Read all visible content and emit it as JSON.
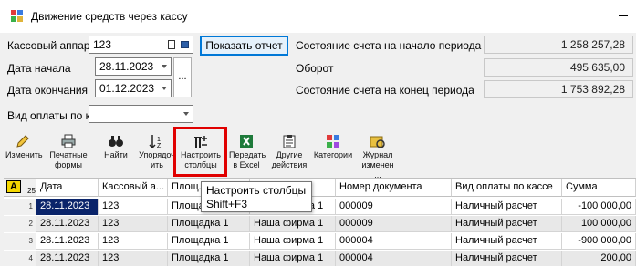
{
  "window": {
    "title": "Движение средств через кассу"
  },
  "form": {
    "register_label": "Кассовый аппара",
    "register_value": "123",
    "start_label": "Дата начала",
    "start_value": "28.11.2023",
    "end_label": "Дата окончания",
    "end_value": "01.12.2023",
    "ellipsis": "...",
    "payment_label": "Вид оплаты по к",
    "payment_value": "",
    "show_report": "Показать отчет"
  },
  "summary": {
    "opening_label": "Состояние счета на начало периода",
    "opening_value": "1 258 257,28",
    "turnover_label": "Оборот",
    "turnover_value": "495 635,00",
    "closing_label": "Состояние счета на конец периода",
    "closing_value": "1 753 892,28"
  },
  "toolbar": {
    "edit": "Изменить",
    "print": "Печатные формы",
    "find": "Найти",
    "sort": "Упорядоч ить",
    "columns": "Настроить столбцы",
    "excel": "Передать в Excel",
    "other": "Другие действия",
    "categories": "Категории",
    "journal": "Журнал изменен ..."
  },
  "tooltip": {
    "title": "Настроить столбцы",
    "shortcut": "Shift+F3"
  },
  "grid": {
    "corner": "A",
    "count": "25",
    "headers": [
      "Дата",
      "Кассовый а...",
      "Площ...",
      "",
      "Номер документа",
      "Вид оплаты по кассе",
      "Сумма"
    ],
    "rows": [
      {
        "n": "1",
        "date": "28.11.2023",
        "register": "123",
        "area": "Площадка 1",
        "firm": "Наша фирма 1",
        "doc": "000009",
        "pay": "Наличный расчет",
        "sum": "-100 000,00"
      },
      {
        "n": "2",
        "date": "28.11.2023",
        "register": "123",
        "area": "Площадка 1",
        "firm": "Наша фирма 1",
        "doc": "000009",
        "pay": "Наличный расчет",
        "sum": "100 000,00"
      },
      {
        "n": "3",
        "date": "28.11.2023",
        "register": "123",
        "area": "Площадка 1",
        "firm": "Наша фирма 1",
        "doc": "000004",
        "pay": "Наличный расчет",
        "sum": "-900 000,00"
      },
      {
        "n": "4",
        "date": "28.11.2023",
        "register": "123",
        "area": "Площадка 1",
        "firm": "Наша фирма 1",
        "doc": "000004",
        "pay": "Наличный расчет",
        "sum": "200,00"
      }
    ]
  }
}
